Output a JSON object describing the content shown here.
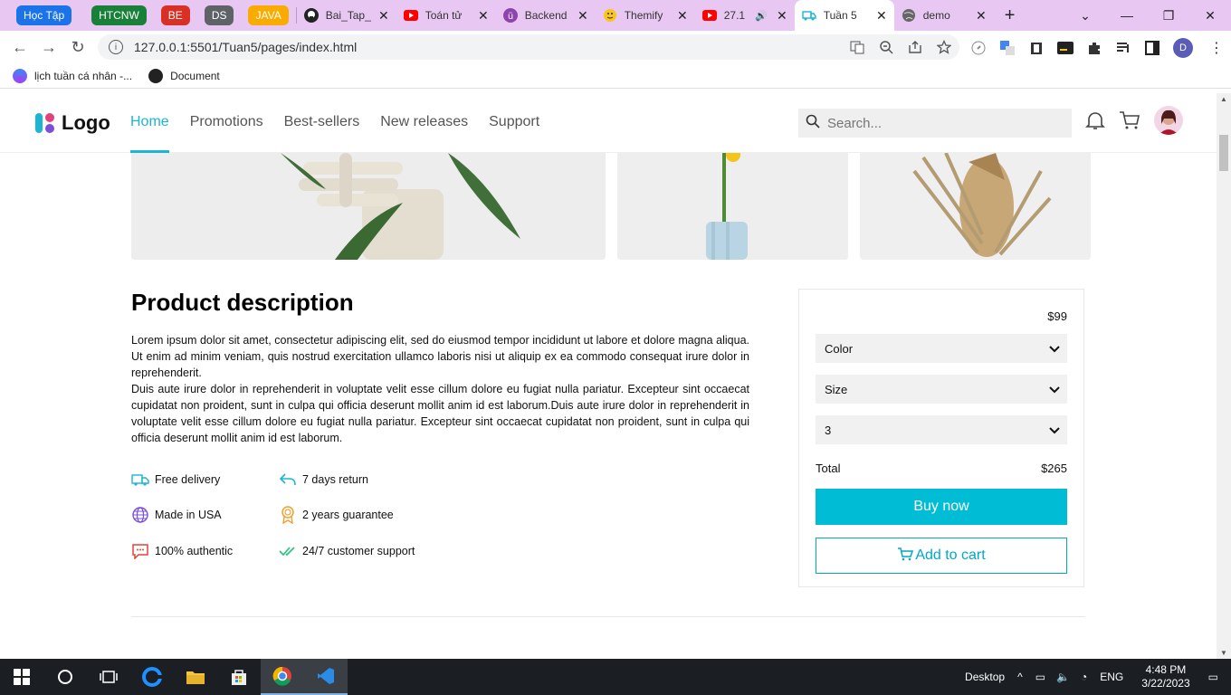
{
  "browser": {
    "tab_groups": [
      {
        "label": "Học Tập",
        "color": "#1a73e8"
      },
      {
        "label": "HTCNW",
        "color": "#188038"
      },
      {
        "label": "BE",
        "color": "#d93025"
      },
      {
        "label": "DS",
        "color": "#5f6368"
      },
      {
        "label": "JAVA",
        "color": "#f9ab00"
      }
    ],
    "tabs": [
      {
        "title": "Bai_Tap_",
        "icon": "github-icon"
      },
      {
        "title": "Toán tử",
        "icon": "youtube-icon"
      },
      {
        "title": "Backend",
        "icon": "udemy-icon"
      },
      {
        "title": "Themify",
        "icon": "emoji-icon"
      },
      {
        "title": "27.1",
        "icon": "youtube-icon"
      },
      {
        "title": "Tuần 5",
        "icon": "truck-icon",
        "active": true
      },
      {
        "title": "demo",
        "icon": "globe-icon"
      }
    ],
    "url": "127.0.0.1:5501/Tuan5/pages/index.html",
    "bookmarks": [
      {
        "label": "lịch tuần cá nhân -...",
        "icon": "calendar-icon"
      },
      {
        "label": "Document",
        "icon": "github-icon"
      }
    ],
    "profile_initial": "D"
  },
  "site": {
    "logo_text": "Logo",
    "nav": [
      "Home",
      "Promotions",
      "Best-sellers",
      "New releases",
      "Support"
    ],
    "search_placeholder": "Search..."
  },
  "product": {
    "description_title": "Product description",
    "description_p1": "Lorem ipsum dolor sit amet, consectetur adipiscing elit, sed do eiusmod tempor incididunt ut labore et dolore magna aliqua. Ut enim ad minim veniam, quis nostrud exercitation ullamco laboris nisi ut aliquip ex ea commodo consequat irure dolor in reprehenderit.",
    "description_p2": "Duis aute irure dolor in reprehenderit in voluptate velit esse cillum dolore eu fugiat nulla pariatur. Excepteur sint occaecat cupidatat non proident, sunt in culpa qui officia deserunt mollit anim id est laborum.Duis aute irure dolor in reprehenderit in voluptate velit esse cillum dolore eu fugiat nulla pariatur. Excepteur sint occaecat cupidatat non proident, sunt in culpa qui officia deserunt mollit anim id est laborum.",
    "features": [
      {
        "label": "Free delivery",
        "icon": "truck-icon",
        "color": "#1bb5d5"
      },
      {
        "label": "7 days return",
        "icon": "return-arrow-icon",
        "color": "#1bb5d5"
      },
      {
        "label": "Made in USA",
        "icon": "globe-icon",
        "color": "#7b4fd6"
      },
      {
        "label": "2 years guarantee",
        "icon": "award-icon",
        "color": "#f0a030"
      },
      {
        "label": "100% authentic",
        "icon": "chat-icon",
        "color": "#e0443a"
      },
      {
        "label": "24/7 customer support",
        "icon": "double-check-icon",
        "color": "#2ec27e"
      }
    ],
    "price": "$99",
    "color_select": "Color",
    "size_select": "Size",
    "quantity_select": "3",
    "total_label": "Total",
    "total_value": "$265",
    "buy_label": "Buy now",
    "cart_label": "Add to cart"
  },
  "taskbar": {
    "desktop_label": "Desktop",
    "language": "ENG",
    "time": "4:48 PM",
    "date": "3/22/2023"
  },
  "colors": {
    "accent": "#00bcd4",
    "tab_bar": "#e8c8f3"
  }
}
